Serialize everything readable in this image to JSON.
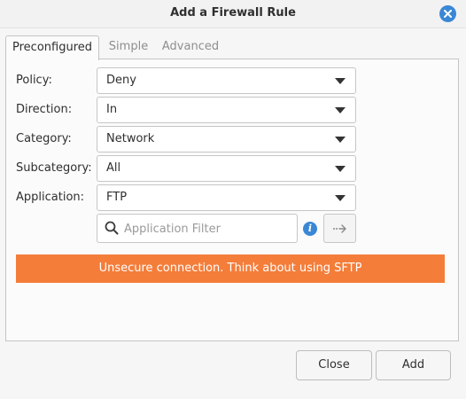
{
  "window": {
    "title": "Add a Firewall Rule",
    "close_icon": "close-icon",
    "accent_color": "#3a87d6"
  },
  "tabs": [
    {
      "label": "Preconfigured",
      "active": true
    },
    {
      "label": "Simple",
      "active": false
    },
    {
      "label": "Advanced",
      "active": false
    }
  ],
  "form": {
    "policy": {
      "label": "Policy:",
      "value": "Deny"
    },
    "direction": {
      "label": "Direction:",
      "value": "In"
    },
    "category": {
      "label": "Category:",
      "value": "Network"
    },
    "subcategory": {
      "label": "Subcategory:",
      "value": "All"
    },
    "application": {
      "label": "Application:",
      "value": "FTP"
    },
    "filter": {
      "placeholder": "Application Filter",
      "value": ""
    }
  },
  "warning": {
    "text": "Unsecure connection. Think about using SFTP",
    "color": "#f47d3a"
  },
  "buttons": {
    "close": "Close",
    "add": "Add"
  }
}
